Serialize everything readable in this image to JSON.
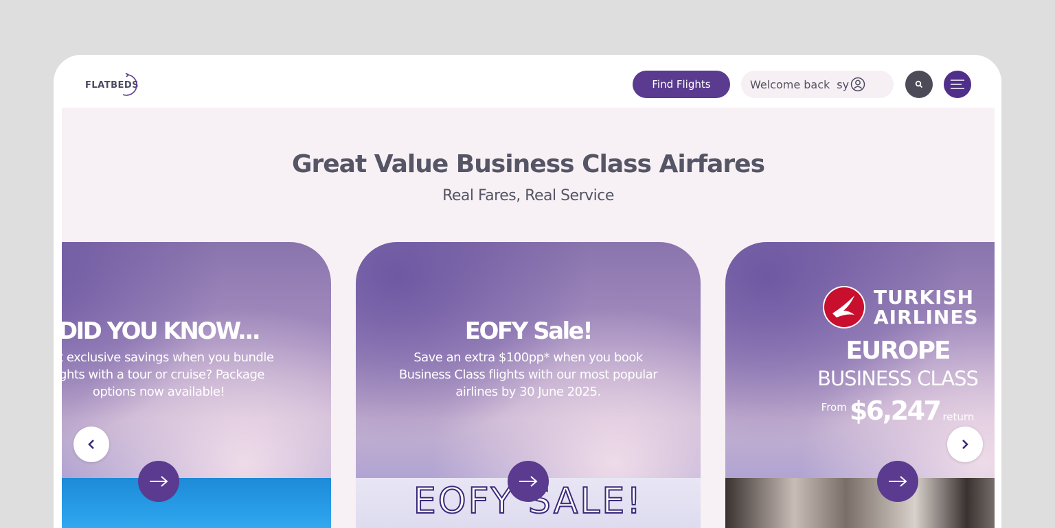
{
  "header": {
    "logo_text": "FLATBEDS",
    "find_flights_label": "Find Flights",
    "welcome_text": "Welcome back",
    "username": "sy",
    "icons": {
      "user": "user-circle-icon",
      "search": "search-icon",
      "menu": "hamburger-menu-icon"
    }
  },
  "hero": {
    "title": "Great Value Business Class Airfares",
    "subtitle": "Real Fares, Real Service"
  },
  "cards": [
    {
      "title": "DID YOU KNOW...",
      "lines": [
        "get exclusive savings when you bundle",
        "lights with a tour or cruise? Package",
        "options now available!"
      ],
      "arrow_icon": "arrow-right-icon"
    },
    {
      "title": "EOFY Sale!",
      "lines": [
        "Save an extra $100pp* when you book",
        "Business Class flights with our most popular",
        "airlines by 30 June 2025."
      ],
      "banner_text": "EOFY SALE!",
      "arrow_icon": "arrow-right-icon"
    },
    {
      "airline": [
        "TURKISH",
        "AIRLINES"
      ],
      "region": "EUROPE",
      "cabin": "BUSINESS CLASS",
      "price_prefix": "From",
      "price": "$6,247",
      "price_suffix": "return",
      "arrow_icon": "arrow-right-icon"
    }
  ],
  "carousel": {
    "prev_icon": "chevron-left-icon",
    "next_icon": "chevron-right-icon"
  },
  "colors": {
    "brand_purple": "#5a3b8f",
    "menu_purple": "#4f2f8a",
    "band_bg": "#f7f1f5",
    "text_gray": "#555566"
  }
}
